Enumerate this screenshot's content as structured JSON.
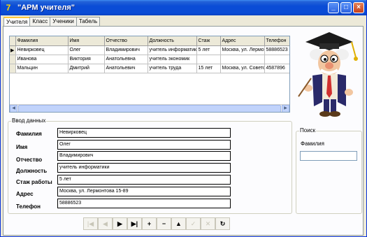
{
  "window": {
    "title": "\"АРМ учителя\""
  },
  "tabs": [
    {
      "label": "Учителя",
      "active": true
    },
    {
      "label": "Класс",
      "active": false
    },
    {
      "label": "Ученики",
      "active": false
    },
    {
      "label": "Табель",
      "active": false
    }
  ],
  "grid": {
    "columns": [
      "Фамилия",
      "Имя",
      "Отчество",
      "Должность",
      "Стаж",
      "Адрес",
      "Телефон"
    ],
    "rows": [
      [
        "Невирковец",
        "Олег",
        "Владимирович",
        "учитель информатик",
        "5 лет",
        "Москва, ул. Лермо",
        "58886523"
      ],
      [
        "Иванова",
        "Виктория",
        "Анатольевна",
        "учитель экономик",
        "",
        "",
        ""
      ],
      [
        "Мальцин",
        "Дмитрий",
        "Анатольевич",
        "учитель труда",
        "15 лет",
        "Москва, ул. Советс",
        "4587896"
      ]
    ],
    "selected_row": 0
  },
  "input_group": {
    "title": "Ввод данных",
    "fields": [
      {
        "label": "Фамилия",
        "value": "Невирковец"
      },
      {
        "label": "Имя",
        "value": "Олег"
      },
      {
        "label": "Отчество",
        "value": "Владимирович"
      },
      {
        "label": "Должность",
        "value": "учитель информатики"
      },
      {
        "label": "Стаж работы",
        "value": "5 лет"
      },
      {
        "label": "Адрес",
        "value": "Москва, ул. Лермонтова 15-89"
      },
      {
        "label": "Телефон",
        "value": "58886523"
      }
    ]
  },
  "search": {
    "group_title": "Поиск",
    "label": "Фамилия",
    "value": ""
  },
  "navigator": [
    {
      "icon": "first-record-icon",
      "glyph": "|◀",
      "enabled": false
    },
    {
      "icon": "prior-record-icon",
      "glyph": "◀",
      "enabled": false
    },
    {
      "icon": "next-record-icon",
      "glyph": "▶",
      "enabled": true
    },
    {
      "icon": "last-record-icon",
      "glyph": "▶|",
      "enabled": true
    },
    {
      "icon": "insert-record-icon",
      "glyph": "+",
      "enabled": true
    },
    {
      "icon": "delete-record-icon",
      "glyph": "−",
      "enabled": true
    },
    {
      "icon": "edit-record-icon",
      "glyph": "▲",
      "enabled": true
    },
    {
      "icon": "post-record-icon",
      "glyph": "✓",
      "enabled": false
    },
    {
      "icon": "cancel-record-icon",
      "glyph": "✕",
      "enabled": false
    },
    {
      "icon": "refresh-record-icon",
      "glyph": "↻",
      "enabled": true
    }
  ]
}
